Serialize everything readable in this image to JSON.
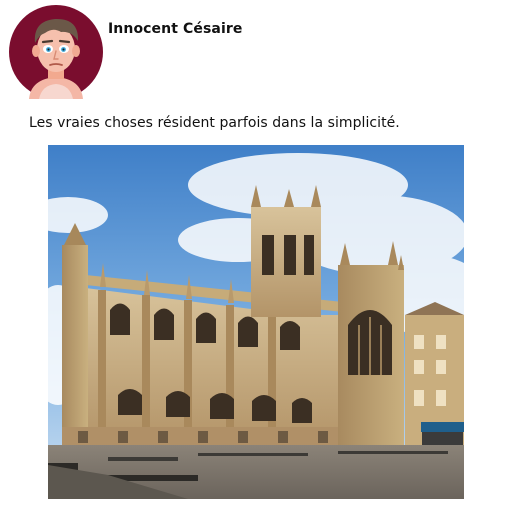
{
  "post": {
    "author_name": "Innocent Césaire",
    "avatar_icon": "cartoon-man-avatar-icon",
    "avatar_bg": "#7a0d2e",
    "text": "Les vraies choses résident parfois dans la simplicité.",
    "photo_subject": "gothic-abbey-photo"
  }
}
